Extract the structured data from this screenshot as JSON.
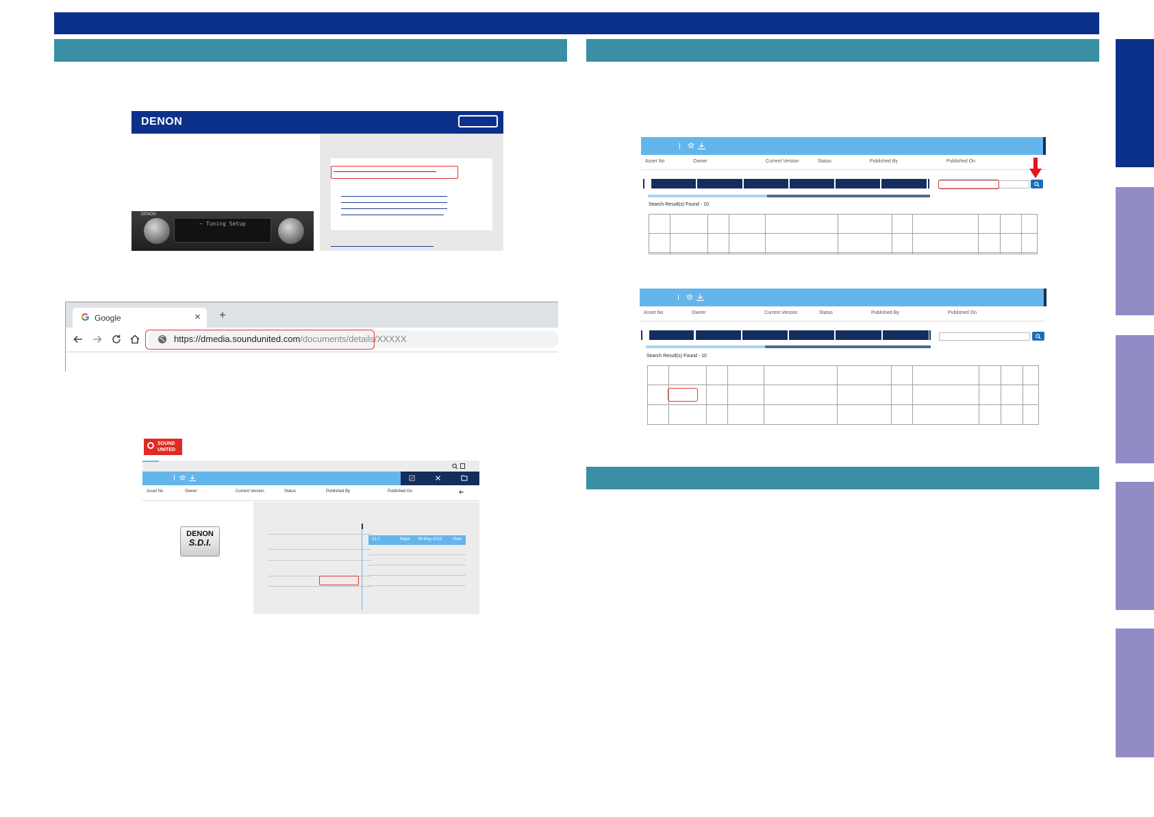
{
  "denon_site": {
    "brand": "DENON",
    "receiver_brand": "DENON",
    "receiver_display": "~ Tuning Setup"
  },
  "browser": {
    "tab_title": "Google",
    "new_tab": "+",
    "close": "×",
    "url_domain": "https://dmedia.soundunited.com",
    "url_path": "/documents/details/XXXXX"
  },
  "soundunited": {
    "logo_line1": "SOUND",
    "logo_line2": "UNITED",
    "columns": [
      "Asset No",
      "Owner",
      "Current Version",
      "Status",
      "Published By",
      "Published On"
    ],
    "sdi_brand": "DENON",
    "sdi_text": "S.D.I.",
    "version_row": [
      "32.2",
      "Major",
      "06-May-2019",
      "View"
    ]
  },
  "dmedia_top": {
    "columns": [
      "Asset No",
      "Owner",
      "Current Version",
      "Status",
      "Published By",
      "Published On"
    ],
    "found_text": "Search Result(s) Found - 10"
  },
  "dmedia_bottom": {
    "columns": [
      "Asset No",
      "Owner",
      "Current Version",
      "Status",
      "Published By",
      "Published On"
    ],
    "found_text": "Search Result(s) Found - 10"
  },
  "colors": {
    "top_bar": "#0c318b",
    "section_bar": "#3a8fa4",
    "side_tab": "#908cc6",
    "side_tab_active": "#0c318b",
    "highlight": "#e23030"
  },
  "icons": [
    "google-icon",
    "back-icon",
    "forward-icon",
    "reload-icon",
    "home-icon",
    "globe-icon",
    "search-icon",
    "close-icon",
    "download-icon",
    "red-arrow-icon"
  ]
}
